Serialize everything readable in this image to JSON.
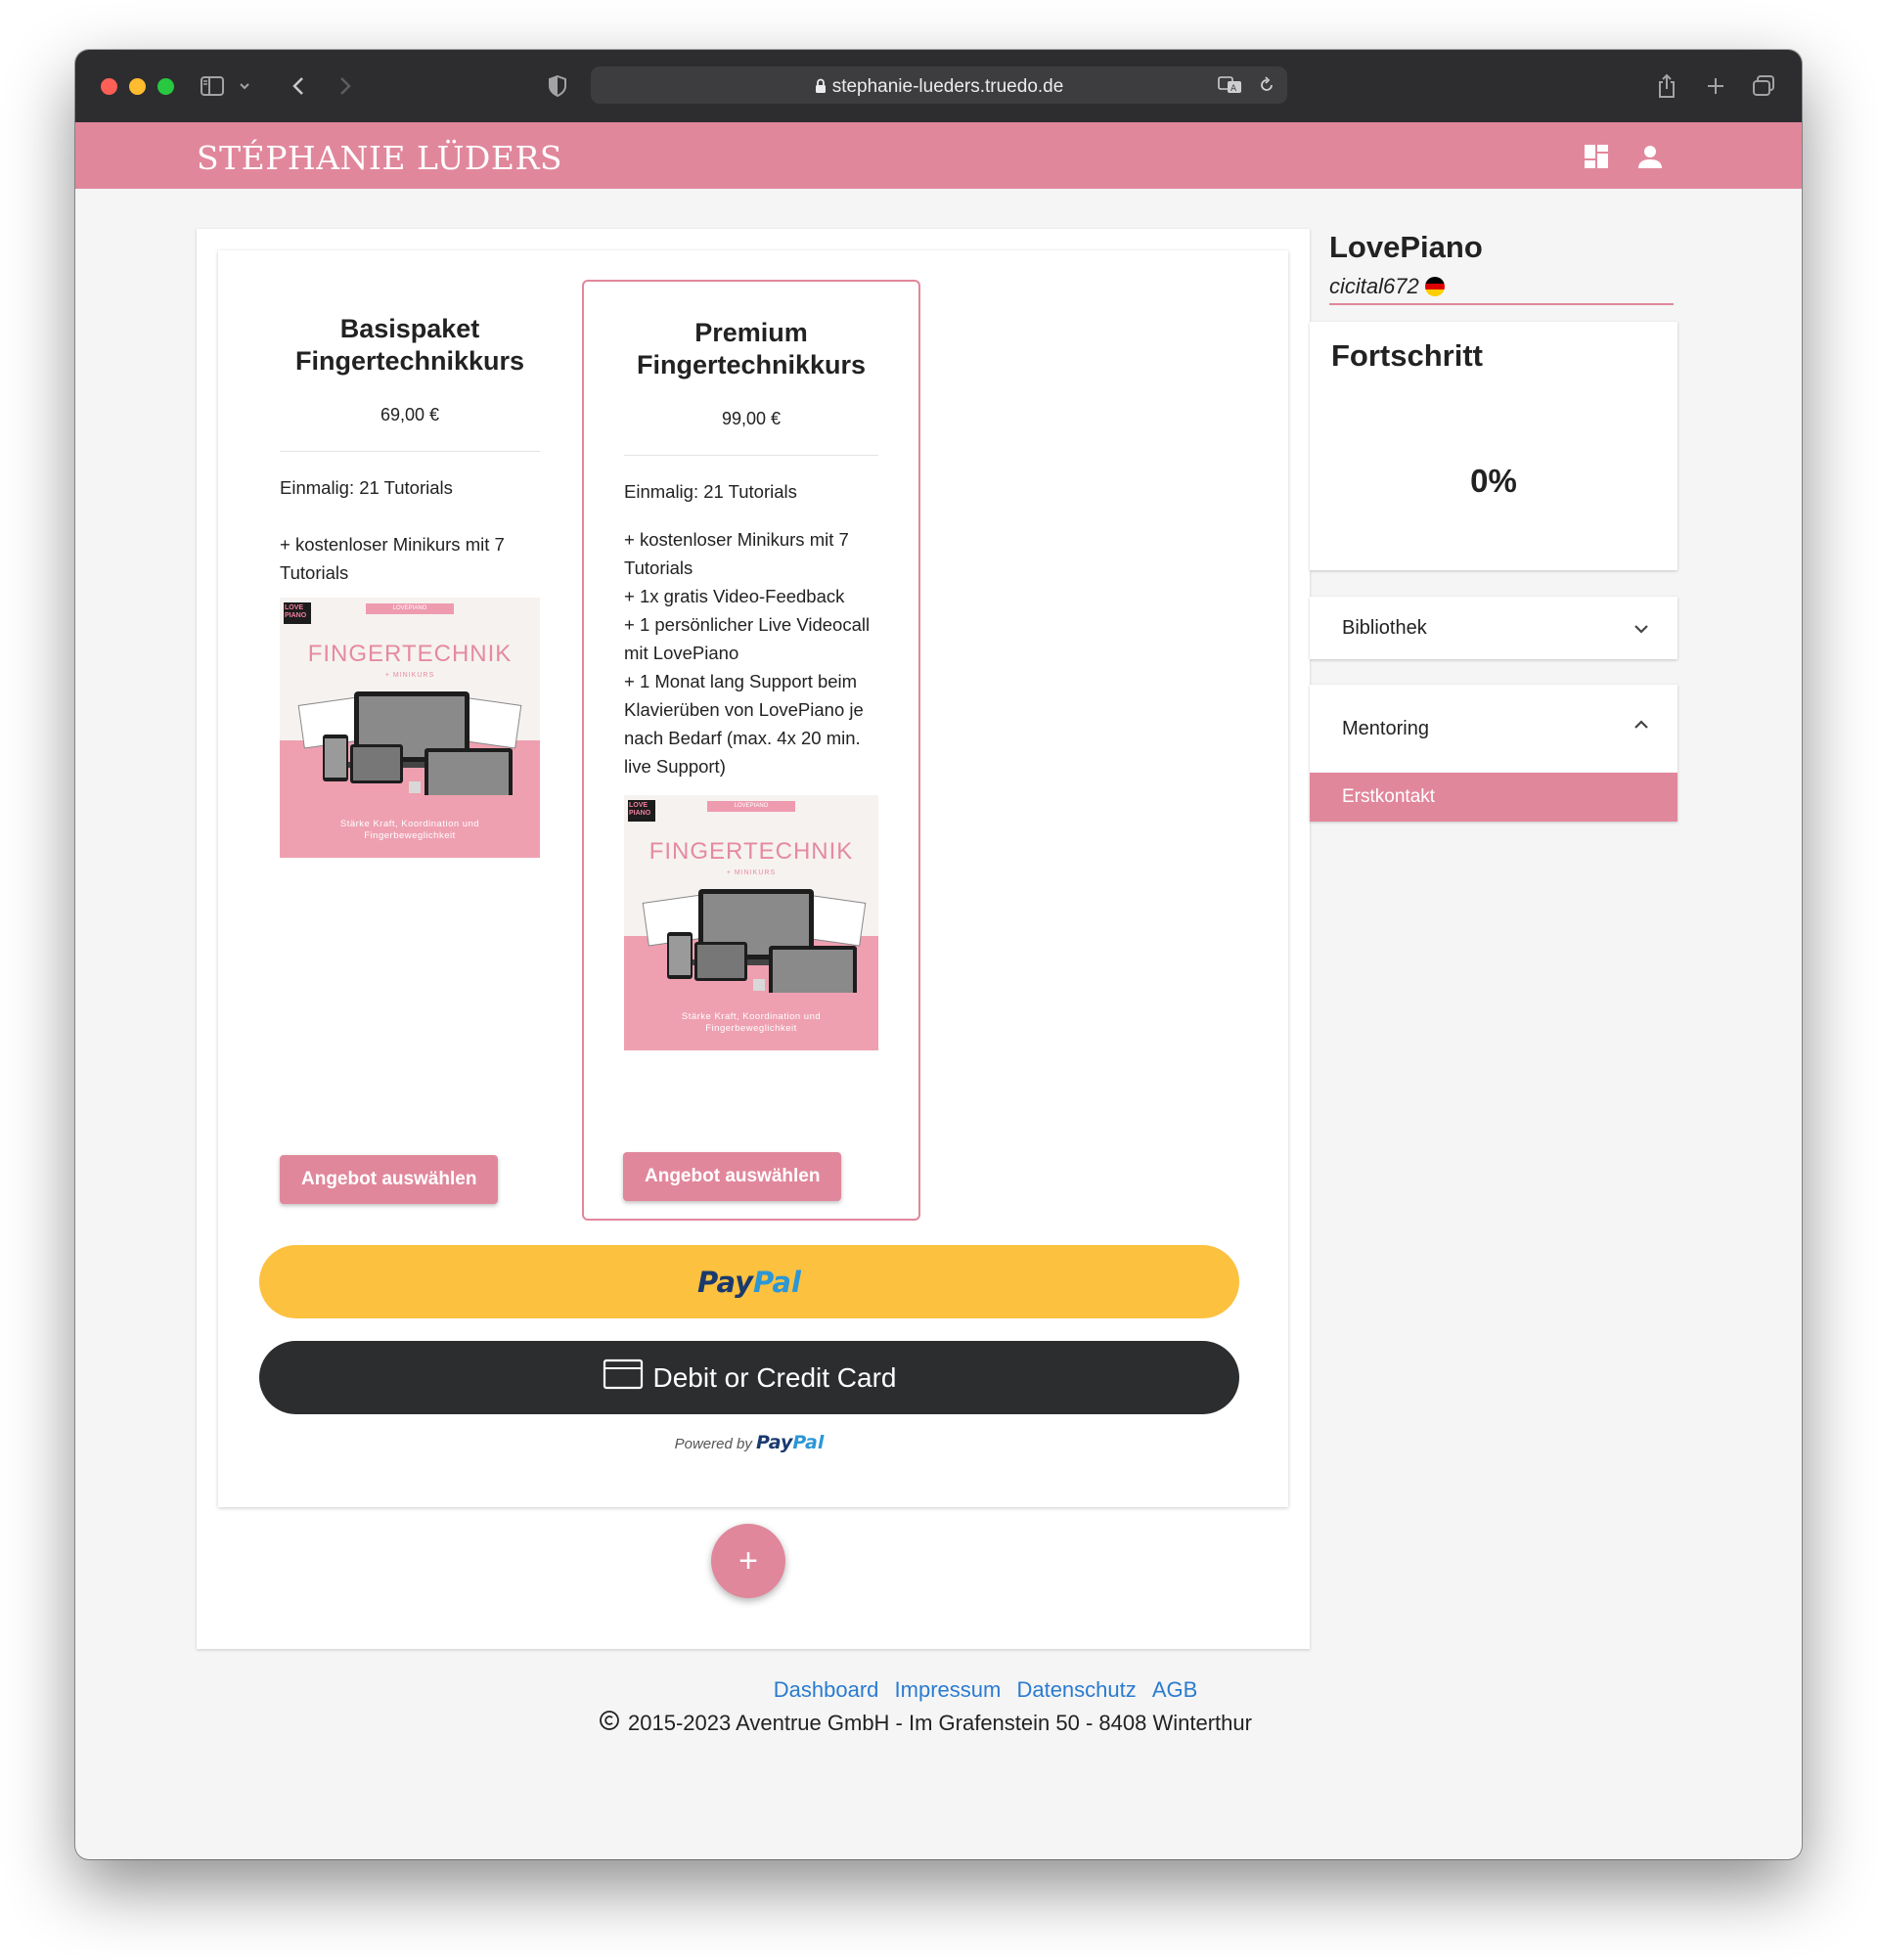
{
  "browser": {
    "url": "stephanie-lueders.truedo.de"
  },
  "header": {
    "brand": "STÉPHANIE LÜDERS"
  },
  "offers": [
    {
      "title_line1": "Basispaket",
      "title_line2": "Fingertechnikkurs",
      "price": "69,00 €",
      "line1": "Einmalig: 21 Tutorials",
      "line2": "+ kostenloser Minikurs mit 7 Tutorials",
      "button": "Angebot auswählen"
    },
    {
      "title_line1": "Premium",
      "title_line2": "Fingertechnikkurs",
      "price": "99,00 €",
      "line1": "Einmalig: 21 Tutorials",
      "features": [
        "+ kostenloser  Minikurs mit 7 Tutorials",
        "+ 1x gratis Video-Feedback",
        "+ 1 persönlicher Live Videocall mit LovePiano",
        "+ 1 Monat lang Support beim Klavierüben von LovePiano je nach  Bedarf (max. 4x 20 min. live Support)"
      ],
      "button": "Angebot auswählen"
    }
  ],
  "product_image": {
    "logo": "LOVE PIANO",
    "small_label": "LOVEPIANO",
    "title": "FINGERTECHNIK",
    "subtitle": "+ MINIKURS",
    "caption_line1": "Stärke Kraft, Koordination und",
    "caption_line2": "Fingerbeweglichkeit"
  },
  "payment": {
    "paypal_pay": "Pay",
    "paypal_pal": "Pal",
    "card_label": "Debit or Credit Card",
    "powered_by": "Powered by"
  },
  "fab": {
    "label": "+"
  },
  "sidebar": {
    "title": "LovePiano",
    "username": "cicital672",
    "progress_title": "Fortschritt",
    "progress_value": "0%",
    "library_label": "Bibliothek",
    "mentoring_label": "Mentoring",
    "mentoring_item": "Erstkontakt"
  },
  "footer": {
    "links": [
      "Dashboard",
      "Impressum",
      "Datenschutz",
      "AGB"
    ],
    "copyright": "2015-2023 Aventrue GmbH - Im Grafenstein 50 - 8408 Winterthur"
  },
  "colors": {
    "brand_pink": "#e1879c",
    "paypal_yellow": "#fcc13f",
    "card_dark": "#2b2d2f",
    "link_blue": "#2a7bd0"
  }
}
